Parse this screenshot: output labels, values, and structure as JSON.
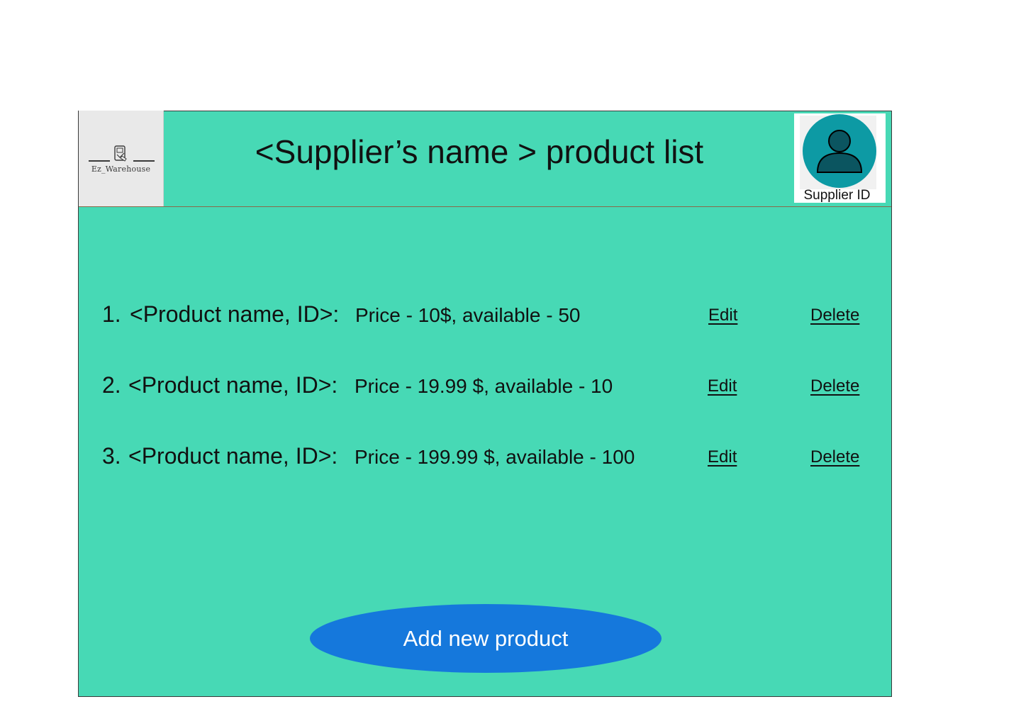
{
  "header": {
    "logo_text": "Ez_Warehouse",
    "title": "<Supplier’s name > product list",
    "supplier_id_label": "Supplier ID"
  },
  "products": [
    {
      "number": "1.",
      "name": "<Product name, ID>:",
      "details": "Price - 10$, available - 50",
      "edit_label": "Edit",
      "delete_label": "Delete"
    },
    {
      "number": "2.",
      "name": "<Product name, ID>:",
      "details": "Price - 19.99 $, available - 10",
      "edit_label": "Edit",
      "delete_label": "Delete"
    },
    {
      "number": "3.",
      "name": "<Product name, ID>:",
      "details": "Price - 199.99 $, available - 100",
      "edit_label": "Edit",
      "delete_label": "Delete"
    }
  ],
  "actions": {
    "add_product_label": "Add new product"
  },
  "icons": {
    "logo": "warehouse-logo-icon",
    "avatar": "user-avatar-icon"
  },
  "colors": {
    "background": "#47d9b5",
    "button": "#1578dc",
    "avatar_circle": "#0d9aa4",
    "avatar_figure": "#0b5560"
  }
}
